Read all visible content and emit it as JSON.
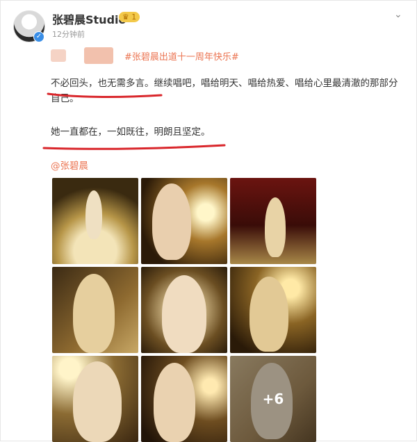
{
  "user": {
    "name": "张碧晨Studio",
    "badge": "1",
    "time": "12分钟前"
  },
  "post": {
    "hashtag": "#张碧晨出道十一周年快乐#",
    "paragraph1": "不必回头，也无需多言。继续唱吧，唱给明天、唱给热爱、唱给心里最清澈的那部分自己。",
    "paragraph2": "她一直都在，一如既往，明朗且坚定。",
    "mention": "@张碧晨",
    "more_photos": "+6"
  },
  "colors": {
    "accent": "#eb7350",
    "underline": "#d9262b"
  }
}
